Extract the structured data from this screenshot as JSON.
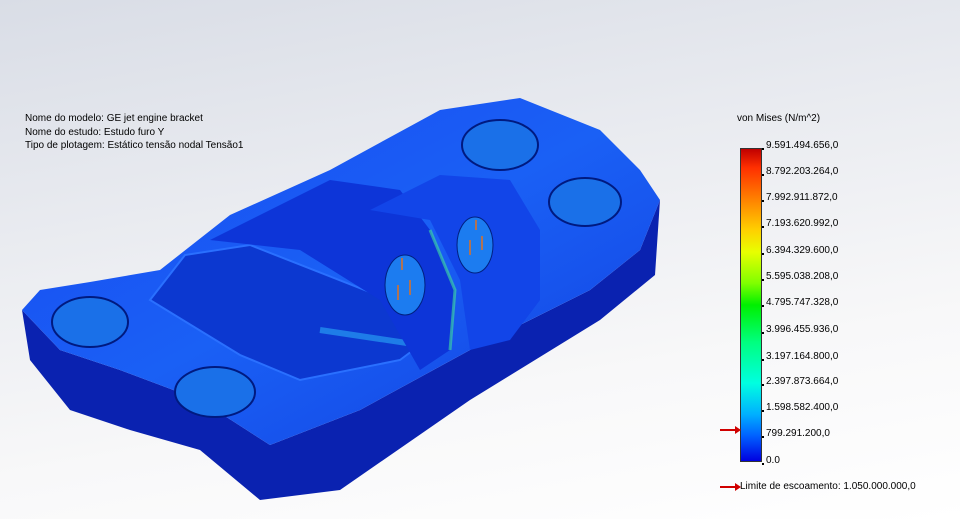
{
  "info": {
    "model_name": "Nome do modelo: GE jet engine bracket",
    "study_name": "Nome do estudo: Estudo furo Y",
    "plot_type": "Tipo de plotagem: Estático tensão nodal Tensão1"
  },
  "legend": {
    "title": "von Mises (N/m^2)",
    "labels": [
      "9.591.494.656,0",
      "8.792.203.264,0",
      "7.992.911.872,0",
      "7.193.620.992,0",
      "6.394.329.600,0",
      "5.595.038.208,0",
      "4.795.747.328,0",
      "3.996.455.936,0",
      "3.197.164.800,0",
      "2.397.873.664,0",
      "1.598.582.400,0",
      "799.291.200,0",
      "0.0"
    ],
    "yield_label": "Limite de escoamento: 1.050.000.000,0",
    "yield_arrow_color": "#d00000"
  }
}
